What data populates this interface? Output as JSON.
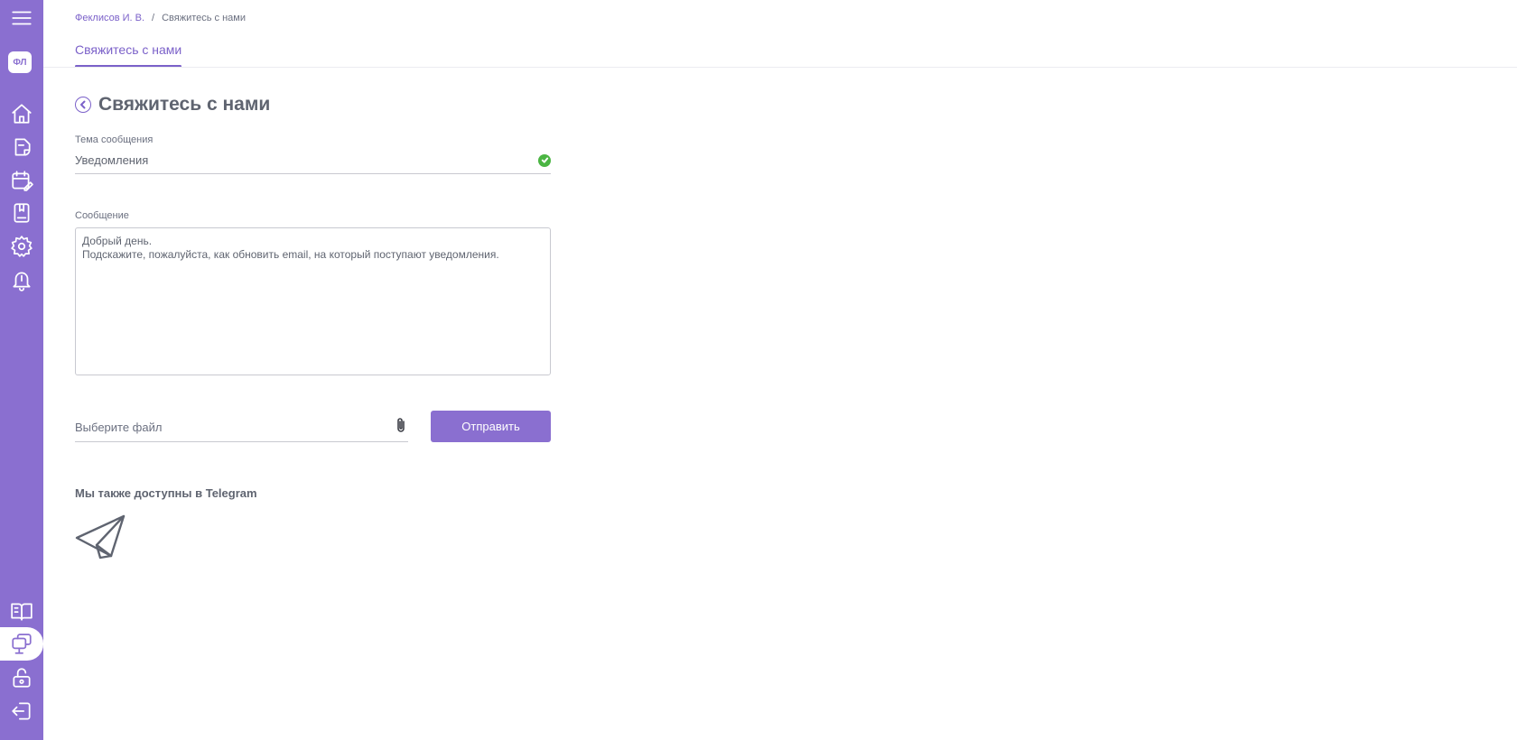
{
  "sidebar": {
    "avatar_initials": "ФЛ",
    "top_icons": [
      "menu-icon",
      "home-icon",
      "document-icon",
      "calendar-edit-icon",
      "book-icon",
      "gear-icon",
      "bell-icon"
    ],
    "bottom_icons": [
      "open-book-icon",
      "support-chat-icon",
      "unlock-icon",
      "logout-icon"
    ],
    "active_icon": "support-chat-icon",
    "accent_color": "#8a6fd0"
  },
  "breadcrumb": {
    "user": "Феклисов И. В.",
    "separator": "/",
    "current": "Свяжитесь с нами"
  },
  "tabs": [
    {
      "label": "Свяжитесь с нами",
      "active": true
    }
  ],
  "page": {
    "title": "Свяжитесь с нами"
  },
  "form": {
    "subject_label": "Тема сообщения",
    "subject_value": "Уведомления",
    "subject_valid": true,
    "message_label": "Сообщение",
    "message_value": "Добрый день.\nПодскажите, пожалуйста, как обновить email, на который поступают уведомления.",
    "file_placeholder": "Выберите файл",
    "submit_label": "Отправить"
  },
  "telegram": {
    "heading": "Мы также доступны в Telegram",
    "icon": "paper-plane-icon"
  },
  "colors": {
    "accent": "#8a6fd0",
    "accent_text": "#7b61c9",
    "valid": "#4bb543",
    "text": "#5f6470"
  }
}
